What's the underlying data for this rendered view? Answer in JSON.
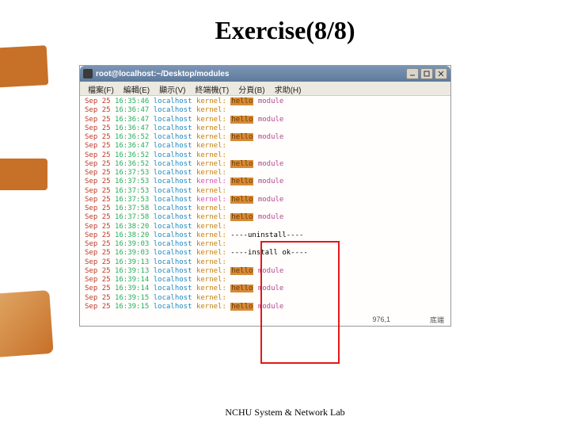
{
  "slide": {
    "title": "Exercise(8/8)",
    "footer": "NCHU System & Network Lab"
  },
  "window": {
    "title": "root@localhost:~/Desktop/modules",
    "btn_min": "_",
    "btn_max": "□",
    "btn_close": "×"
  },
  "menu": {
    "file": "檔案(F)",
    "edit": "編輯(E)",
    "view": "顯示(V)",
    "terminal": "終端機(T)",
    "tabs": "分頁(B)",
    "help": "求助(H)"
  },
  "status": {
    "pos": "976,1",
    "mode": "底端"
  },
  "log": {
    "month": "Sep",
    "day": "25",
    "host": "localhost",
    "kernel": "kernel:",
    "tag_hello": "hello",
    "module": "module",
    "uninstall": "----uninstall----",
    "install": "----install ok----",
    "rows": [
      {
        "t": "16:35:46",
        "msg": "hello_mod"
      },
      {
        "t": "16:36:47",
        "msg": "blank"
      },
      {
        "t": "16:36:47",
        "msg": "hello_mod"
      },
      {
        "t": "16:36:47",
        "msg": "blank"
      },
      {
        "t": "16:36:52",
        "msg": "hello_mod"
      },
      {
        "t": "16:36:47",
        "msg": "blank"
      },
      {
        "t": "16:36:52",
        "msg": "blank"
      },
      {
        "t": "16:36:52",
        "msg": "hello_mod"
      },
      {
        "t": "16:37:53",
        "msg": "blank"
      },
      {
        "t": "16:37:53",
        "msg": "hello_mod_pink"
      },
      {
        "t": "16:37:53",
        "msg": "blank"
      },
      {
        "t": "16:37:53",
        "msg": "hello_mod_pink"
      },
      {
        "t": "16:37:58",
        "msg": "blank"
      },
      {
        "t": "16:37:58",
        "msg": "hello_mod"
      },
      {
        "t": "16:38:20",
        "msg": "blank"
      },
      {
        "t": "16:38:20",
        "msg": "uninstall"
      },
      {
        "t": "16:39:03",
        "msg": "blank"
      },
      {
        "t": "16:39:03",
        "msg": "install"
      },
      {
        "t": "16:39:13",
        "msg": "blank"
      },
      {
        "t": "16:39:13",
        "msg": "hello_mod"
      },
      {
        "t": "16:39:14",
        "msg": "blank"
      },
      {
        "t": "16:39:14",
        "msg": "hello_mod"
      },
      {
        "t": "16:39:15",
        "msg": "blank"
      },
      {
        "t": "16:39:15",
        "msg": "hello_mod"
      }
    ]
  }
}
